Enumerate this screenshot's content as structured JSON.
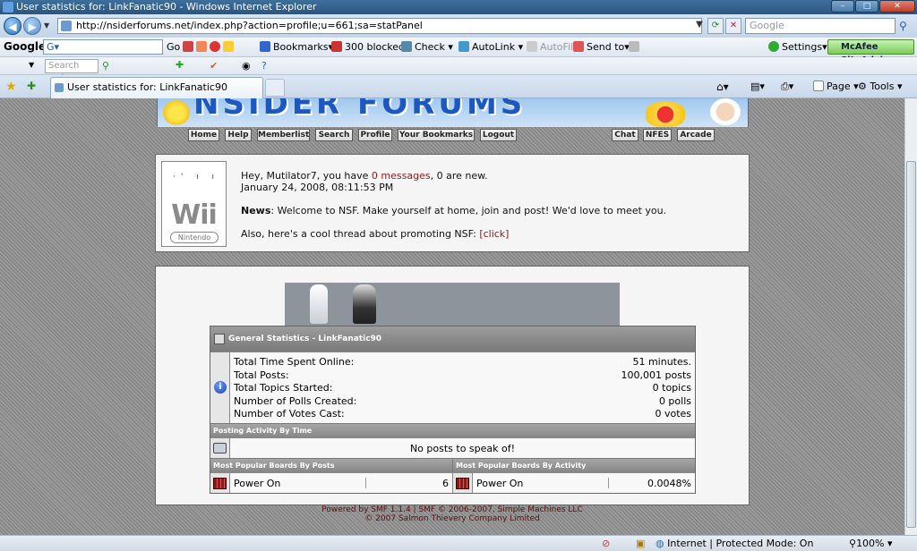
{
  "window": {
    "title": "User statistics for: LinkFanatic90 - Windows Internet Explorer",
    "minimize": "–",
    "maximize": "□",
    "close": "✕"
  },
  "address_bar": {
    "url": "http://nsiderforums.net/index.php?action=profile;u=661;sa=statPanel",
    "search_placeholder": "Google"
  },
  "google_toolbar": {
    "logo": "Google",
    "search_value": "G▾",
    "go": "Go",
    "bookmarks": "Bookmarks▾",
    "blocked": "300 blocked",
    "check": "Check ▾",
    "autolink": "AutoLink ▾",
    "autofill": "AutoFill",
    "send_to": "Send to▾",
    "settings": "Settings▾",
    "mcafee": "McAfee SiteAdvisor ▾"
  },
  "second_toolbar": {
    "search_placeholder": "Search web..."
  },
  "tabs": {
    "active_label": "User statistics for: LinkFanatic90",
    "commands": {
      "page": "Page ▾",
      "tools": "Tools ▾"
    }
  },
  "forum_nav": {
    "left": [
      "Home",
      "Help",
      "Memberlist",
      "Search",
      "Profile",
      "Your Bookmarks",
      "Logout"
    ],
    "right": [
      "Chat",
      "NFES",
      "Arcade"
    ]
  },
  "user_panel": {
    "avatar_text": "Wii",
    "avatar_badge": "Nintendo",
    "greeting_pre": "Hey, Mutilator7, you have ",
    "messages_link": "0 messages",
    "greeting_post": ", 0 are new.",
    "datetime": "January 24, 2008, 08:11:53 PM",
    "news_label": "News",
    "news_text": ": Welcome to NSF. Make yourself at home, join and post! We'd love to meet you.",
    "promo_text": "Also, here's a cool thread about promoting NSF: ",
    "promo_link": "[click]"
  },
  "stats": {
    "general_header": "General Statistics - LinkFanatic90",
    "rows": [
      {
        "label": "Total Time Spent Online:",
        "value": "51 minutes."
      },
      {
        "label": "Total Posts:",
        "value": "100,001 posts"
      },
      {
        "label": "Total Topics Started:",
        "value": "0 topics"
      },
      {
        "label": "Number of Polls Created:",
        "value": "0 polls"
      },
      {
        "label": "Number of Votes Cast:",
        "value": "0 votes"
      }
    ],
    "activity_header": "Posting Activity By Time",
    "no_posts": "No posts to speak of!",
    "popular_posts_header": "Most Popular Boards By Posts",
    "popular_activity_header": "Most Popular Boards By Activity",
    "popular_posts_board": "Power On",
    "popular_posts_value": "6",
    "popular_activity_board": "Power On",
    "popular_activity_value": "0.0048%"
  },
  "footer": {
    "line1": "Powered by SMF 1.1.4 | SMF © 2006-2007, Simple Machines LLC",
    "line2": "© 2007 Salmon Thievery Company Limited"
  },
  "status_bar": {
    "zone": "Internet | Protected Mode: On",
    "zoom": "100%"
  }
}
